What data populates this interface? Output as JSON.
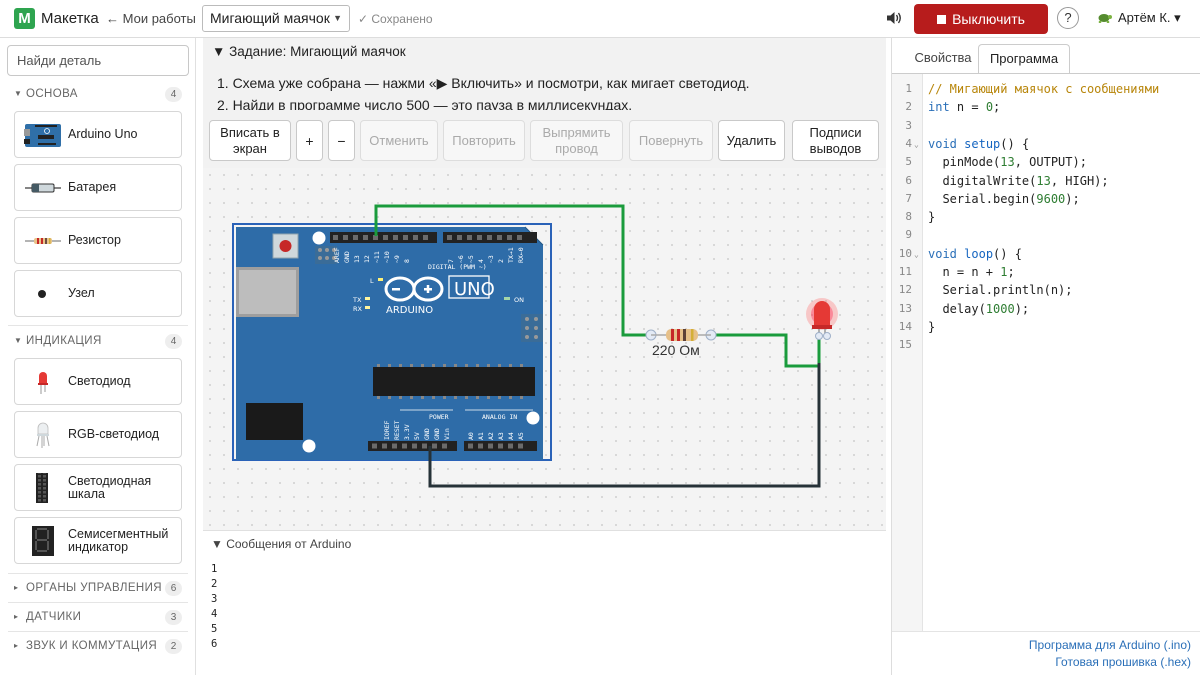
{
  "topbar": {
    "logo_letter": "М",
    "app_name": "Макетка",
    "back_link": "← Мои работы",
    "project_name": "Мигающий маячок",
    "saved_status": "✓ Сохранено",
    "power_label": "Выключить",
    "help_label": "?",
    "user_name": "Артём К. ▾",
    "accent_color": "#b71c1c",
    "brand_color": "#2ea44f"
  },
  "sidebar": {
    "search_placeholder": "Найди деталь",
    "categories": [
      {
        "label": "ОСНОВА",
        "count": "4",
        "expanded": true,
        "items": [
          {
            "label": "Arduino Uno",
            "icon": "arduino-board-icon"
          },
          {
            "label": "Батарея",
            "icon": "battery-icon"
          },
          {
            "label": "Резистор",
            "icon": "resistor-icon"
          },
          {
            "label": "Узел",
            "icon": "node-dot-icon"
          }
        ]
      },
      {
        "label": "ИНДИКАЦИЯ",
        "count": "4",
        "expanded": true,
        "items": [
          {
            "label": "Светодиод",
            "icon": "led-icon"
          },
          {
            "label": "RGB-светодиод",
            "icon": "rgb-led-icon"
          },
          {
            "label": "Светодиодная шкала",
            "label_lines": [
              "Светодиодная",
              "шкала"
            ],
            "icon": "led-bar-icon"
          },
          {
            "label": "Семисегментный индикатор",
            "label_lines": [
              "Семисегментный",
              "индикатор"
            ],
            "icon": "seven-segment-icon"
          }
        ]
      },
      {
        "label": "ОРГАНЫ УПРАВЛЕНИЯ",
        "count": "6",
        "expanded": false
      },
      {
        "label": "ДАТЧИКИ",
        "count": "3",
        "expanded": false
      },
      {
        "label": "ЗВУК И КОММУТАЦИЯ",
        "count": "2",
        "expanded": false
      }
    ]
  },
  "task": {
    "title": "▼ Задание: Мигающий маячок",
    "steps": [
      "1. Схема уже собрана — нажми «▶ Включить» и посмотри, как мигает светодиод.",
      "2. Найди в программе число 500 — это пауза в миллисекундах."
    ]
  },
  "toolbar": {
    "fit_lines": [
      "Вписать в",
      "экран"
    ],
    "zoom_in": "+",
    "zoom_out": "−",
    "undo": "Отменить",
    "redo": "Повторить",
    "straighten_lines": [
      "Выпрямить",
      "провод"
    ],
    "rotate": "Повернуть",
    "delete": "Удалить",
    "pin_labels_lines": [
      "Подписи",
      "выводов"
    ]
  },
  "canvas": {
    "board": {
      "brand": "ARDUINO",
      "model": "UNO",
      "digital_label": "DIGITAL (PWM ~)",
      "power_label": "POWER",
      "analog_label": "ANALOG IN",
      "on_label": "ON",
      "tx_label": "TX",
      "rx_label": "RX",
      "l_label": "L",
      "top_pins": [
        "AREF",
        "GND",
        "13",
        "12",
        "~11",
        "~10",
        "~9",
        "8",
        "7",
        "~6",
        "~5",
        "4",
        "~3",
        "2",
        "TX→1",
        "RX←0"
      ],
      "bottom_pins": [
        "IOREF",
        "RESET",
        "3.3V",
        "5V",
        "GND",
        "GND",
        "Vin",
        "A0",
        "A1",
        "A2",
        "A3",
        "A4",
        "A5"
      ]
    },
    "resistor_label": "220 Ом",
    "wire_colors": {
      "signal": "#1a9b3c",
      "ground": "#263238"
    },
    "led_color": "#e53935"
  },
  "messages": {
    "title": "▼ Сообщения от Arduino",
    "lines": [
      "1",
      "2",
      "3",
      "4",
      "5",
      "6"
    ]
  },
  "right": {
    "tabs": [
      "Свойства",
      "Программа"
    ],
    "active_tab": "Программа",
    "code_lines": [
      "// Мигающий маячок с сообщениями",
      "int n = 0;",
      "",
      "void setup() {",
      "  pinMode(13, OUTPUT);",
      "  digitalWrite(13, HIGH);",
      "  Serial.begin(9600);",
      "}",
      "",
      "void loop() {",
      "  n = n + 1;",
      "  Serial.println(n);",
      "  delay(1000);",
      "}",
      ""
    ],
    "link_ino": "Программа для Arduino (.ino)",
    "link_hex": "Готовая прошивка (.hex)"
  }
}
